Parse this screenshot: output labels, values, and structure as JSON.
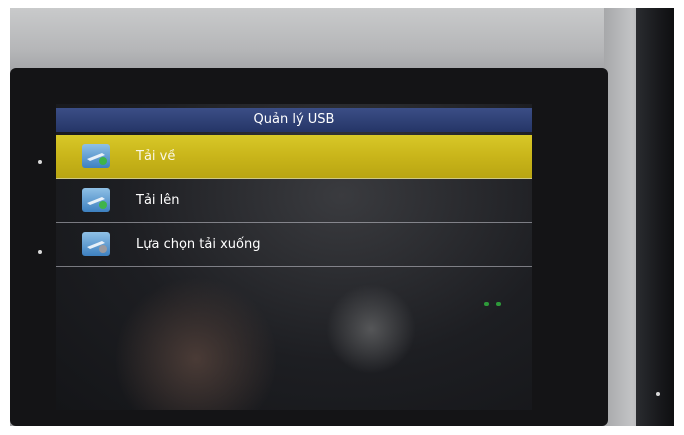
{
  "window": {
    "title": "Quản lý USB"
  },
  "menu": {
    "items": [
      {
        "label": "Tải về",
        "icon": "download-icon",
        "selected": true
      },
      {
        "label": "Tải lên",
        "icon": "upload-icon",
        "selected": false
      },
      {
        "label": "Lựa chọn tải xuống",
        "icon": "download-options-icon",
        "selected": false
      }
    ]
  },
  "colors": {
    "title_bar": "#2f4176",
    "selected_item": "#c9b51a",
    "screen_background": "#1d1e22",
    "text": "#ffffff"
  }
}
